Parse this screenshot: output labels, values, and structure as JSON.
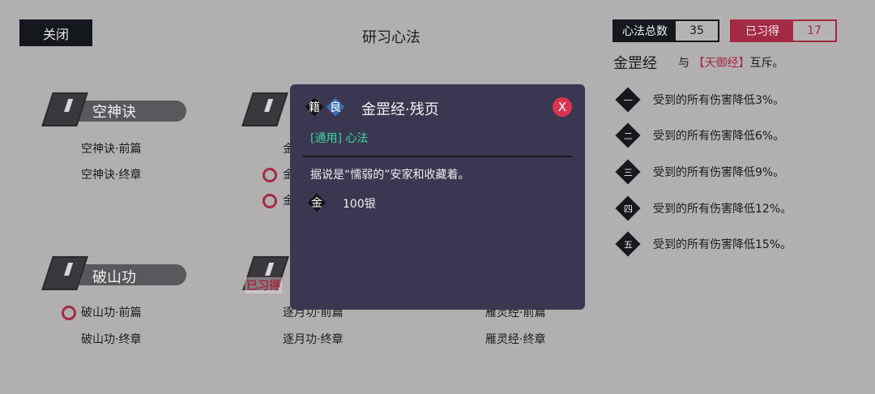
{
  "header": {
    "close_label": "关闭",
    "title": "研习心法"
  },
  "stats": {
    "total_label": "心法总数",
    "total_value": "35",
    "acquired_label": "已习得",
    "acquired_value": "17"
  },
  "detail": {
    "name": "金罡经",
    "conflict_prefix": "与",
    "conflict_target": "【天御经】",
    "conflict_suffix": "互斥。",
    "effects": [
      {
        "level": "一",
        "text": "受到的所有伤害降低3%。"
      },
      {
        "level": "二",
        "text": "受到的所有伤害降低6%。"
      },
      {
        "level": "三",
        "text": "受到的所有伤害降低9%。"
      },
      {
        "level": "四",
        "text": "受到的所有伤害降低12%。"
      },
      {
        "level": "五",
        "text": "受到的所有伤害降低15%。"
      }
    ]
  },
  "groups": [
    {
      "title": "空神诀",
      "chapters": [
        "空神诀·前篇",
        "空神诀·终章"
      ]
    },
    {
      "title": "",
      "chapters": [
        "金",
        "金",
        "金"
      ]
    },
    {
      "title": "破山功",
      "chapters": [
        "破山功·前篇",
        "破山功·终章"
      ]
    },
    {
      "title": "",
      "chapters": [
        "逐月功·前篇",
        "逐月功·终章"
      ],
      "stamp": "已习得"
    },
    {
      "title": "",
      "chapters": [
        "雁灵经·前篇",
        "雁灵经·终章"
      ]
    }
  ],
  "modal": {
    "type_badge": "籍",
    "grade_badge": "良",
    "title": "金罡经·残页",
    "subtitle": "[通用] 心法",
    "description": "据说是“懦弱的”安家和收藏着。",
    "price_badge": "金",
    "price": "100银",
    "close_label": "X"
  },
  "colors": {
    "accent_red": "#a32a43",
    "accent_green": "#3fd4a0",
    "modal_bg": "#3a3850",
    "page_bg": "#b2afb0"
  }
}
